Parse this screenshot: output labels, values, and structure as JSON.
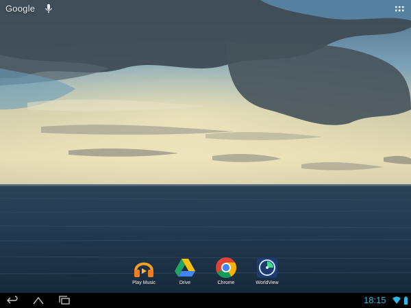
{
  "search": {
    "logo_text": "Google",
    "mic_icon": "mic-icon",
    "apps_icon": "all-apps-icon"
  },
  "hotseat": {
    "apps": [
      {
        "label": "Play Music",
        "icon": "play-music-icon"
      },
      {
        "label": "Drive",
        "icon": "drive-icon"
      },
      {
        "label": "Chrome",
        "icon": "chrome-icon"
      },
      {
        "label": "WorldView",
        "icon": "worldview-icon"
      }
    ]
  },
  "navbar": {
    "back_icon": "back-icon",
    "home_icon": "home-icon",
    "recents_icon": "recents-icon"
  },
  "status": {
    "time": "18:15",
    "wifi_icon": "wifi-icon",
    "battery_icon": "battery-icon",
    "accent_color": "#33b5e5"
  }
}
